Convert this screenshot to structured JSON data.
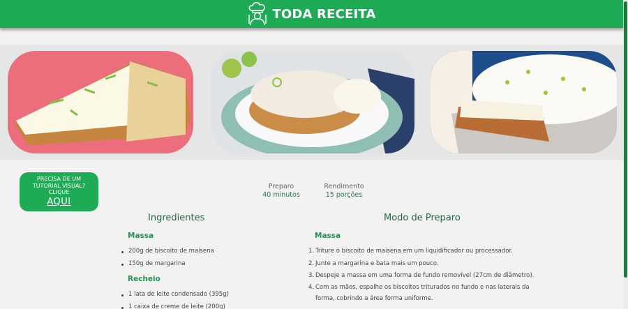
{
  "header": {
    "logo_text": "TODA RECEITA"
  },
  "tutorial": {
    "line1": "PRECISA DE UM TUTORIAL VISUAL?",
    "line2": "CLIQUE",
    "link": "AQUI"
  },
  "stats": [
    {
      "label": "Preparo",
      "value": "40 minutos"
    },
    {
      "label": "Rendimento",
      "value": "15 porções"
    }
  ],
  "ingredients": {
    "title": "Ingredientes",
    "sections": [
      {
        "name": "Massa",
        "items": [
          "200g de biscoito de maisena",
          "150g de margarina"
        ]
      },
      {
        "name": "Recheio",
        "items": [
          "1 lata de leite condensado (395g)",
          "1 caixa de creme de leite (200g)"
        ]
      }
    ]
  },
  "preparation": {
    "title": "Modo de Preparo",
    "section": "Massa",
    "steps": [
      "Triture o biscoito de maisena em um liquidificador ou processador.",
      "Junte a margarina e bata mais um pouco.",
      "Despeje a massa em uma forma de fundo removível (27cm de diâmetro).",
      "Com as mãos, espalhe os biscoitos triturados no fundo e nas laterais da",
      "forma, cobrindo a área forma uniforme."
    ],
    "step_numbers": [
      "1.",
      "2.",
      "3.",
      "4."
    ]
  },
  "colors": {
    "brand_green": "#1fab56",
    "dark_green": "#1c6b3a"
  },
  "icons": {
    "logo": "chef-icon"
  }
}
